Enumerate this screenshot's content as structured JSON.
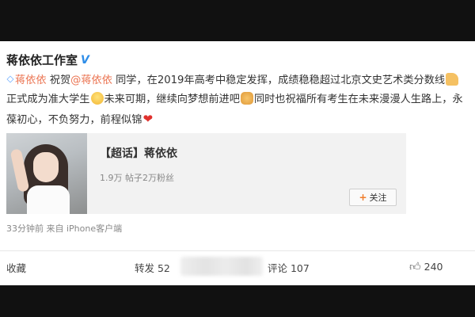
{
  "post": {
    "account_name": "蒋依依工作室",
    "verified_badge": "V",
    "text": {
      "mention_1": "蒋依依",
      "seg_1": "祝贺",
      "mention_2": "@蒋依依",
      "seg_2": "同学，在2019年高考中稳定发挥，成绩稳稳超过北京文史艺术类分数线",
      "seg_3": "正式成为准大学生",
      "seg_4": "未来可期，继续向梦想前进吧",
      "seg_5": "同时也祝福所有考生在未来漫漫人生路上，永葆初心，不负努力，前程似锦"
    },
    "emoji_icons": [
      "thumbs-up-icon",
      "happy-face-icon",
      "fist-bump-icon",
      "red-heart-icon"
    ],
    "accent_color": "#eb7350"
  },
  "topic_card": {
    "title": "【超话】蒋依依",
    "stats": "1.9万  帖子2万粉丝",
    "follow_label": "关注"
  },
  "meta": {
    "time_source": "33分钟前 来自 iPhone客户端"
  },
  "actions": {
    "favorite": "收藏",
    "repost": "转发 52",
    "comment": "评论 107",
    "like": "240"
  }
}
